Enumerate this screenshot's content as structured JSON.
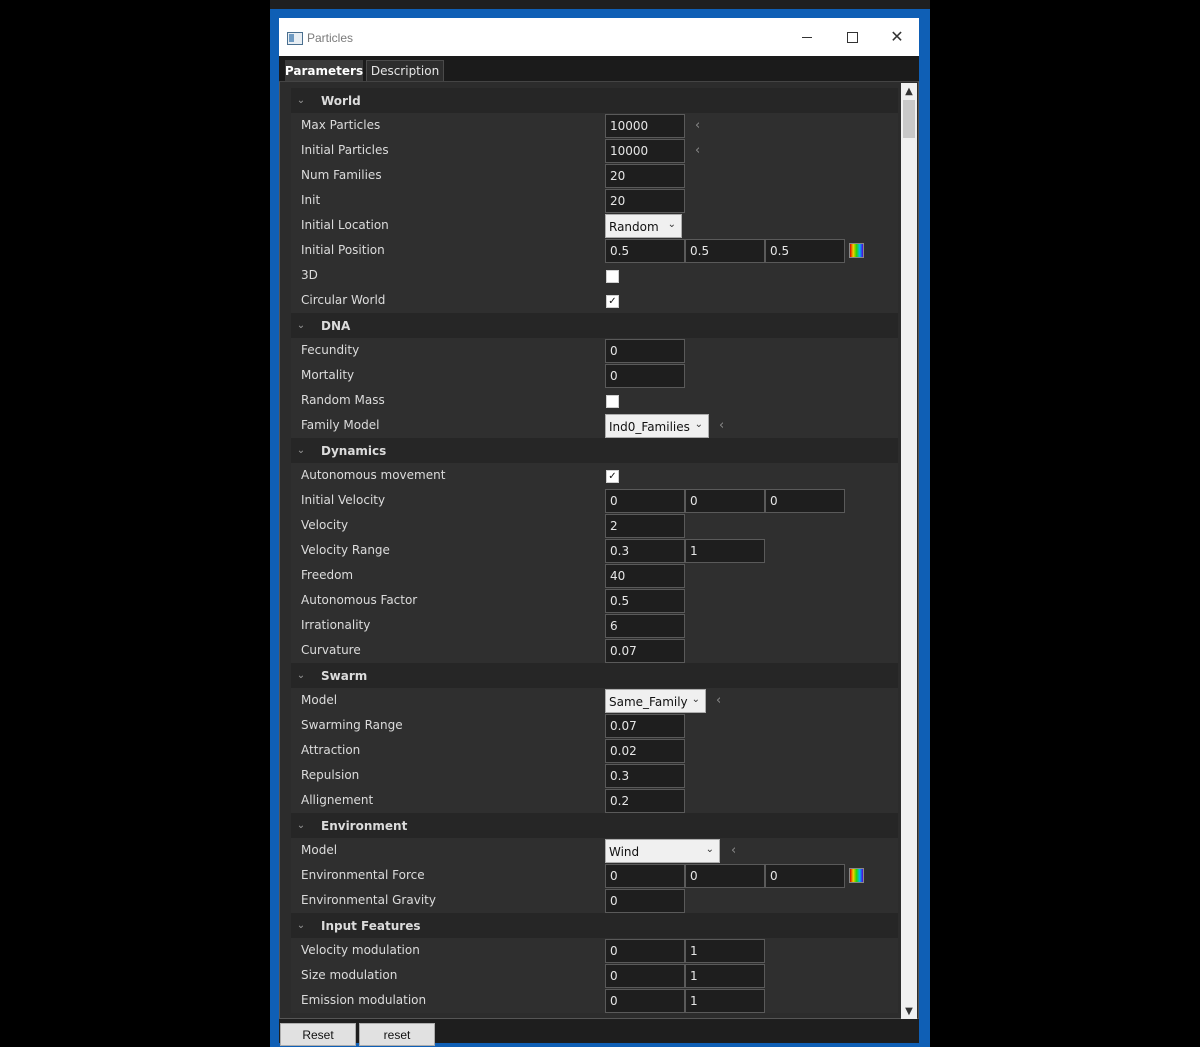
{
  "window": {
    "title": "Particles",
    "close_glyph": "✕"
  },
  "tabs": [
    {
      "label": "Parameters",
      "active": true
    },
    {
      "label": "Description",
      "active": false
    }
  ],
  "sections": {
    "world": {
      "title": "World",
      "max_particles": {
        "label": "Max Particles",
        "value": "10000"
      },
      "initial_particles": {
        "label": "Initial Particles",
        "value": "10000"
      },
      "num_families": {
        "label": "Num Families",
        "value": "20"
      },
      "init": {
        "label": "Init",
        "value": "20"
      },
      "initial_location": {
        "label": "Initial Location",
        "value": "Random"
      },
      "initial_position": {
        "label": "Initial Position",
        "values": [
          "0.5",
          "0.5",
          "0.5"
        ]
      },
      "three_d": {
        "label": "3D",
        "checked": false
      },
      "circular_world": {
        "label": "Circular World",
        "checked": true
      }
    },
    "dna": {
      "title": "DNA",
      "fecundity": {
        "label": "Fecundity",
        "value": "0"
      },
      "mortality": {
        "label": "Mortality",
        "value": "0"
      },
      "random_mass": {
        "label": "Random Mass",
        "checked": false
      },
      "family_model": {
        "label": "Family Model",
        "value": "Ind0_Families"
      }
    },
    "dynamics": {
      "title": "Dynamics",
      "autonomous_movement": {
        "label": "Autonomous movement",
        "checked": true
      },
      "initial_velocity": {
        "label": "Initial Velocity",
        "values": [
          "0",
          "0",
          "0"
        ]
      },
      "velocity": {
        "label": "Velocity",
        "value": "2"
      },
      "velocity_range": {
        "label": "Velocity Range",
        "values": [
          "0.3",
          "1"
        ]
      },
      "freedom": {
        "label": "Freedom",
        "value": "40"
      },
      "autonomous_factor": {
        "label": "Autonomous Factor",
        "value": "0.5"
      },
      "irrationality": {
        "label": "Irrationality",
        "value": "6"
      },
      "curvature": {
        "label": "Curvature",
        "value": "0.07"
      }
    },
    "swarm": {
      "title": "Swarm",
      "model": {
        "label": "Model",
        "value": "Same_Family"
      },
      "swarming_range": {
        "label": "Swarming Range",
        "value": "0.07"
      },
      "attraction": {
        "label": "Attraction",
        "value": "0.02"
      },
      "repulsion": {
        "label": "Repulsion",
        "value": "0.3"
      },
      "allignement": {
        "label": "Allignement",
        "value": "0.2"
      }
    },
    "environment": {
      "title": "Environment",
      "model": {
        "label": "Model",
        "value": "Wind"
      },
      "environmental_force": {
        "label": "Environmental Force",
        "values": [
          "0",
          "0",
          "0"
        ]
      },
      "environmental_gravity": {
        "label": "Environmental Gravity",
        "value": "0"
      }
    },
    "input_features": {
      "title": "Input Features",
      "velocity_modulation": {
        "label": "Velocity modulation",
        "values": [
          "0",
          "1"
        ]
      },
      "size_modulation": {
        "label": "Size modulation",
        "values": [
          "0",
          "1"
        ]
      },
      "emission_modulation": {
        "label": "Emission modulation",
        "values": [
          "0",
          "1"
        ]
      }
    }
  },
  "glyphs": {
    "chevron": "⌄",
    "caret": "⌄",
    "back_arrow": "‹",
    "check": "✓",
    "scroll_up": "▲",
    "scroll_down": "▼"
  },
  "bottom": {
    "reset_primary": "Reset",
    "reset_secondary": "reset"
  }
}
